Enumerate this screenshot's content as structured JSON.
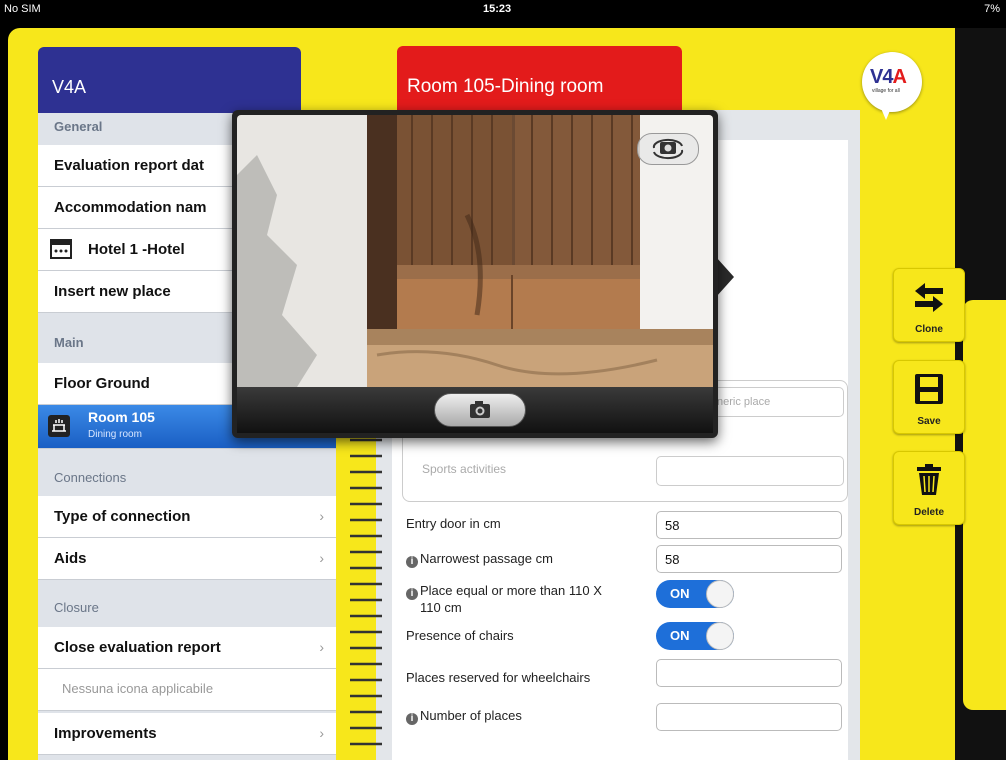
{
  "status_bar": {
    "carrier": "No SIM",
    "time": "15:23",
    "battery": "7%"
  },
  "left_tab": {
    "title": "V4A"
  },
  "right_tab": {
    "title": "Room 105-Dining room"
  },
  "logo": {
    "text_main": "V4",
    "text_accent": "A",
    "tagline": "village for all"
  },
  "sidebar": {
    "general_header": "General",
    "evaluation_report_date": "Evaluation report dat",
    "accommodation_name": "Accommodation nam",
    "hotel": "Hotel 1 -Hotel",
    "insert_new_place": "Insert new place",
    "main_header": "Main",
    "floor": "Floor Ground",
    "selected_room": {
      "title": "Room 105",
      "subtitle": "Dining room"
    },
    "connections_header": "Connections",
    "type_of_connection": "Type of connection",
    "aids": "Aids",
    "closure_header": "Closure",
    "close_evaluation_report": "Close evaluation report",
    "no_icon": "Nessuna icona applicabile",
    "improvements": "Improvements",
    "chevron": "›"
  },
  "form": {
    "generic_place_placeholder": "neric place",
    "sports_activities": "Sports activities",
    "entry_door_label": "Entry door in cm",
    "entry_door_value": "58",
    "narrowest_passage_label": "Narrowest passage cm",
    "narrowest_passage_value": "58",
    "place_equal_label_1": "Place equal or more than 110 X",
    "place_equal_label_2": "110 cm",
    "place_equal_toggle": "ON",
    "presence_chairs_label": "Presence of chairs",
    "presence_chairs_toggle": "ON",
    "places_reserved_label": "Places reserved for wheelchairs",
    "places_reserved_value": "",
    "number_places_label": "Number of places",
    "number_places_value": ""
  },
  "actions": {
    "clone": "Clone",
    "save": "Save",
    "delete": "Delete"
  },
  "camera": {
    "shutter_icon": "camera-icon",
    "switch_icon": "switch-camera-icon"
  },
  "colors": {
    "folder_yellow": "#f7e71b",
    "tab_blue": "#2e3192",
    "tab_red": "#e31b1b",
    "selection_blue": "#1a5fc4",
    "toggle_blue": "#1e6fd9"
  }
}
